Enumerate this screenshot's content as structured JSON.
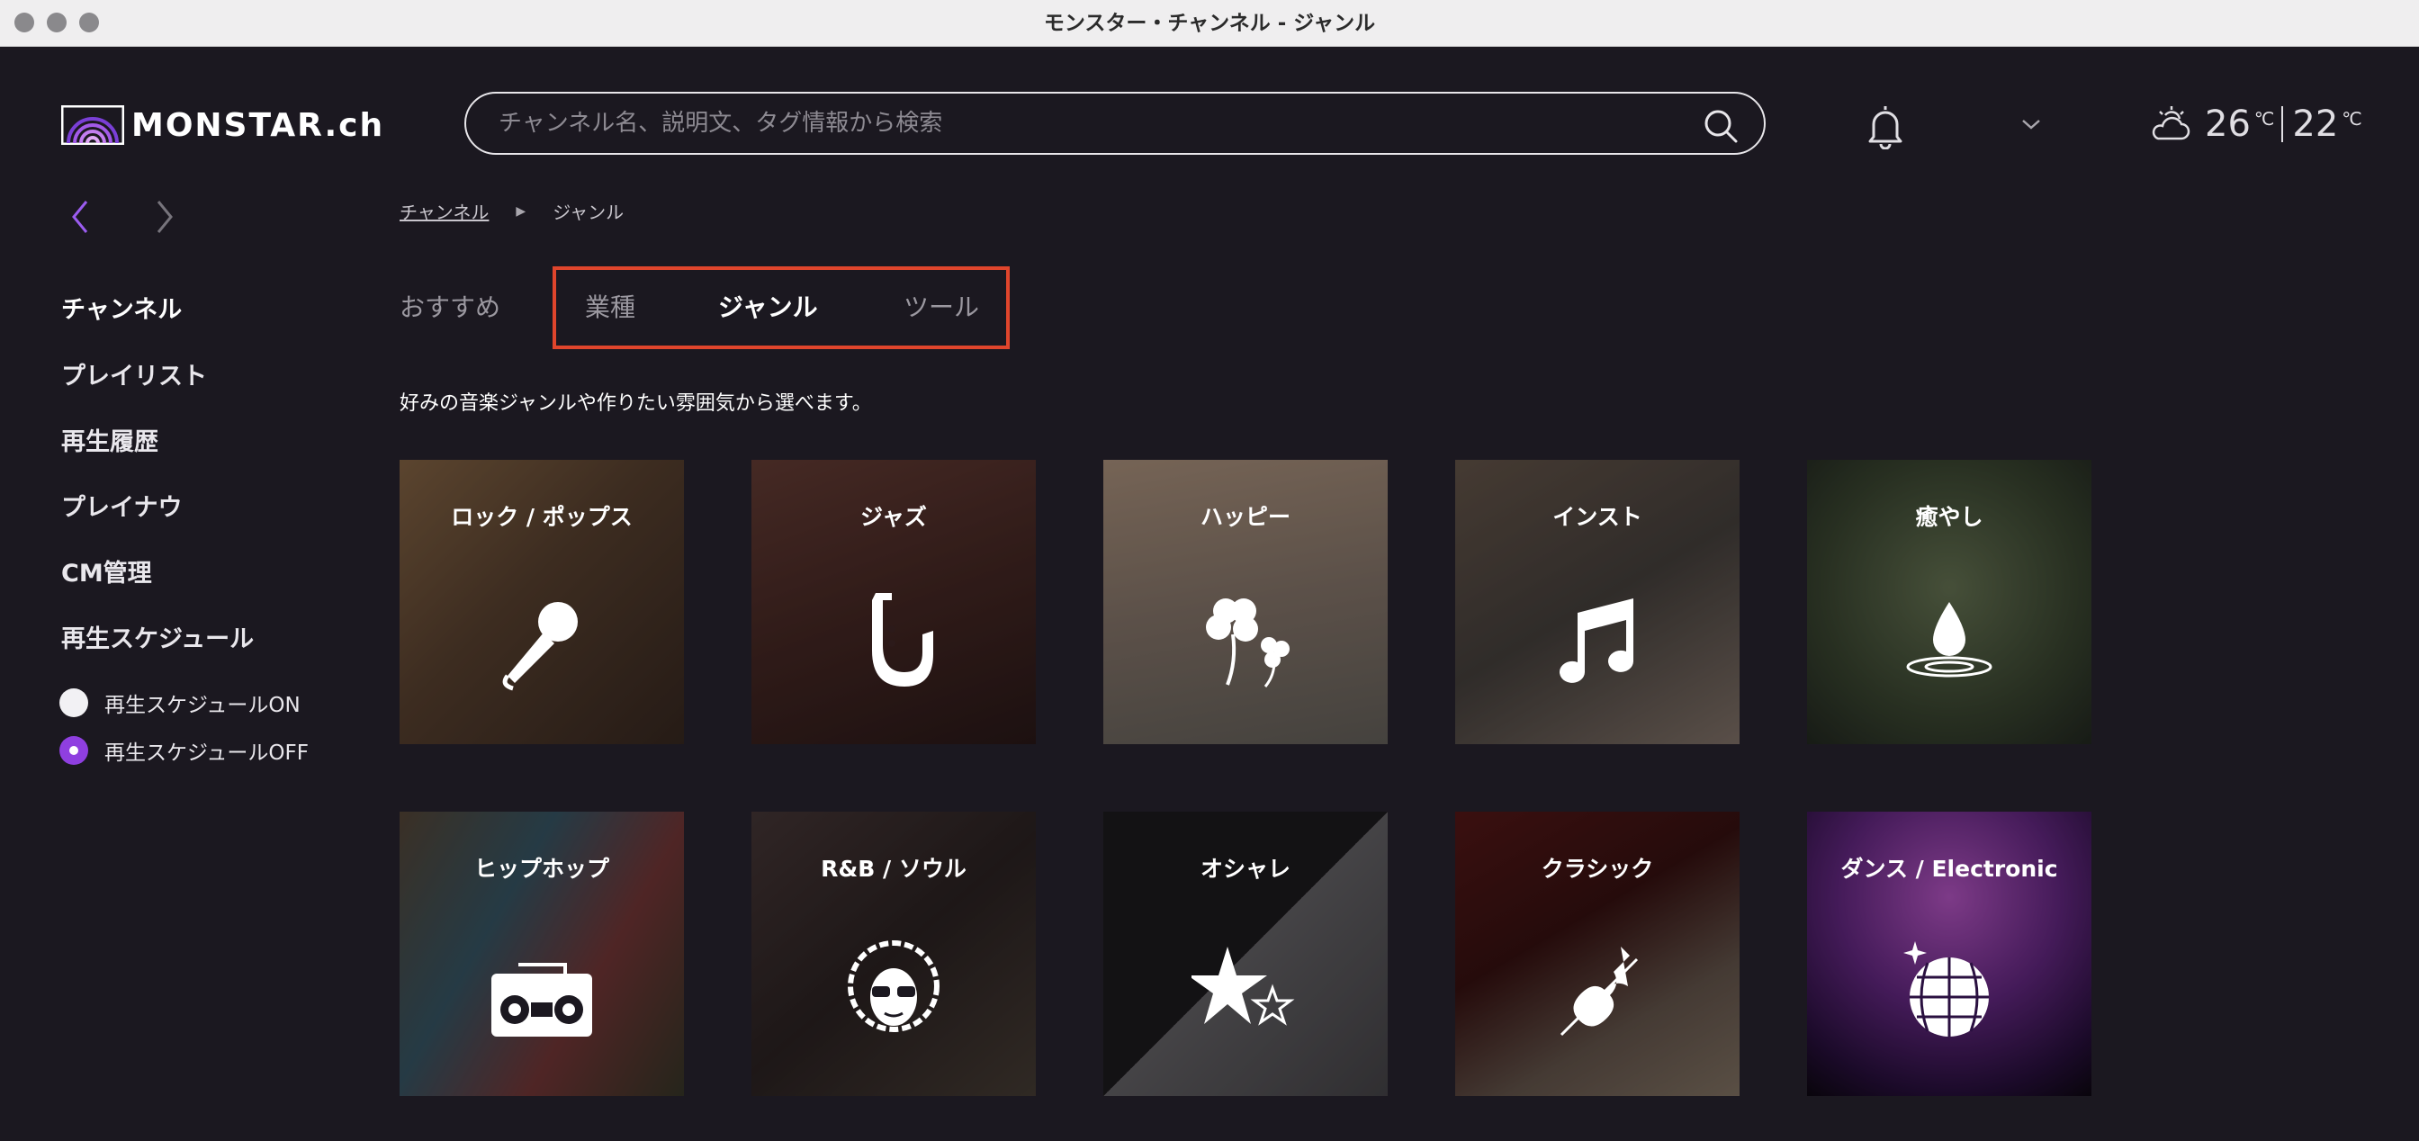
{
  "window": {
    "title": "モンスター・チャンネル -  ジャンル"
  },
  "header": {
    "logo_text": "MONSTAR.ch",
    "search_placeholder": "チャンネル名、説明文、タグ情報から検索",
    "weather": {
      "high": "26",
      "low": "22",
      "unit": "℃"
    }
  },
  "sidebar": {
    "items": [
      {
        "label": "チャンネル"
      },
      {
        "label": "プレイリスト"
      },
      {
        "label": "再生履歴"
      },
      {
        "label": "プレイナウ"
      },
      {
        "label": "CM管理"
      },
      {
        "label": "再生スケジュール"
      }
    ],
    "schedule_options": [
      {
        "label": "再生スケジュールON",
        "selected": false
      },
      {
        "label": "再生スケジュールOFF",
        "selected": true
      }
    ]
  },
  "breadcrumb": {
    "parent": "チャンネル",
    "current": "ジャンル"
  },
  "tabs": [
    {
      "label": "おすすめ",
      "active": false
    },
    {
      "label": "業種",
      "active": false
    },
    {
      "label": "ジャンル",
      "active": true
    },
    {
      "label": "ツール",
      "active": false
    }
  ],
  "subtitle": "好みの音楽ジャンルや作りたい雰囲気から選べます。",
  "genres": [
    {
      "label": "ロック / ポップス",
      "icon": "microphone-icon"
    },
    {
      "label": "ジャズ",
      "icon": "saxophone-icon"
    },
    {
      "label": "ハッピー",
      "icon": "clover-icon"
    },
    {
      "label": "インスト",
      "icon": "music-note-icon"
    },
    {
      "label": "癒やし",
      "icon": "water-drop-icon"
    },
    {
      "label": "ヒップホップ",
      "icon": "boombox-icon"
    },
    {
      "label": "R&B / ソウル",
      "icon": "afro-sunglasses-icon"
    },
    {
      "label": "オシャレ",
      "icon": "stars-icon"
    },
    {
      "label": "クラシック",
      "icon": "violin-icon"
    },
    {
      "label": "ダンス / Electronic",
      "icon": "disco-ball-icon"
    }
  ],
  "colors": {
    "accent": "#8f3fe0",
    "highlight": "#e0452c",
    "background": "#1b1820"
  }
}
